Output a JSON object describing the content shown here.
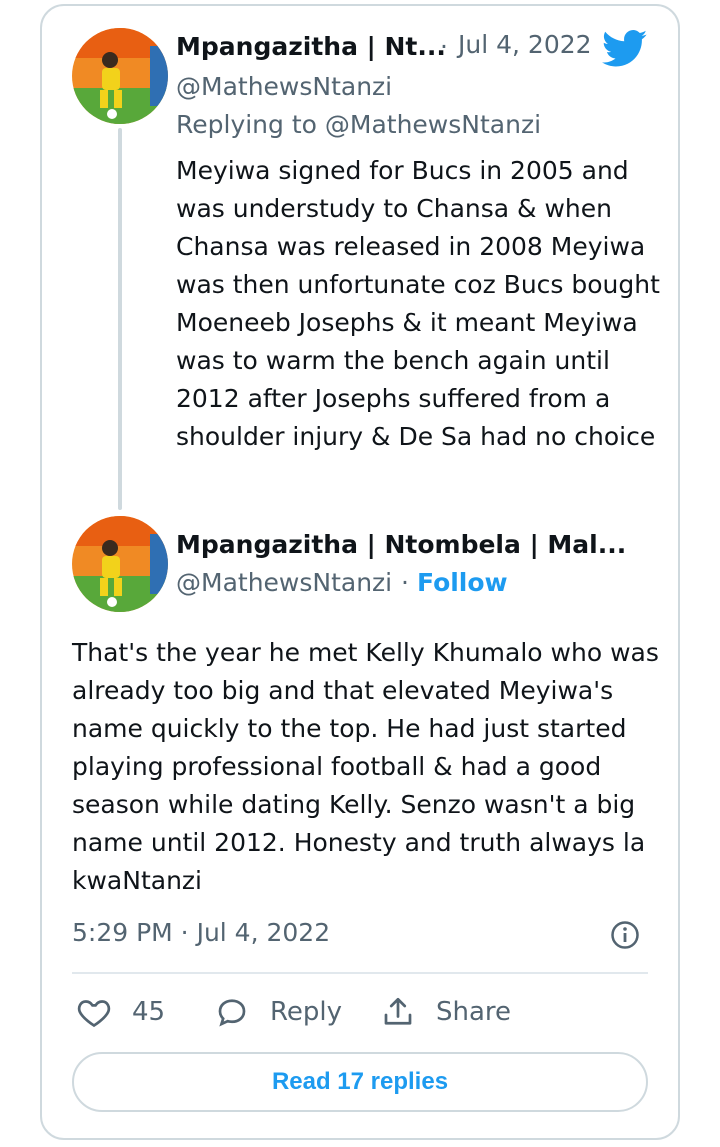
{
  "tweet1": {
    "name": "Mpangazitha | Nt...",
    "date_sep": "·",
    "date": "Jul 4, 2022",
    "handle": "@MathewsNtanzi",
    "replying_to": "Replying to @MathewsNtanzi",
    "text": "Meyiwa signed for Bucs in 2005 and was understudy to  Chansa & when Chansa was released in 2008 Meyiwa was then unfortunate coz Bucs bought Moeneeb Josephs & it meant Meyiwa was to warm the bench again until 2012 after Josephs suffered from a shoulder injury & De Sa had no choice"
  },
  "tweet2": {
    "name": "Mpangazitha | Ntombela | Mal...",
    "handle": "@MathewsNtanzi",
    "sep": "·",
    "follow_label": "Follow",
    "text": "That's the year he met Kelly Khumalo who was already too big and that elevated Meyiwa's name quickly to the top. He had just started playing professional football  & had a good season while dating Kelly. Senzo wasn't a big name until 2012. Honesty and truth always la kwaNtanzi",
    "timestamp": "5:29 PM · Jul 4, 2022"
  },
  "actions": {
    "like_count": "45",
    "reply_label": "Reply",
    "share_label": "Share"
  },
  "read_replies_label": "Read 17 replies",
  "icons": {
    "brand": "twitter-bird-icon",
    "like": "heart-icon",
    "reply": "comment-icon",
    "share": "share-icon",
    "info": "info-icon"
  },
  "colors": {
    "accent": "#1d9bf0",
    "text": "#0f1419",
    "muted": "#536471",
    "border": "#cfd9de"
  }
}
